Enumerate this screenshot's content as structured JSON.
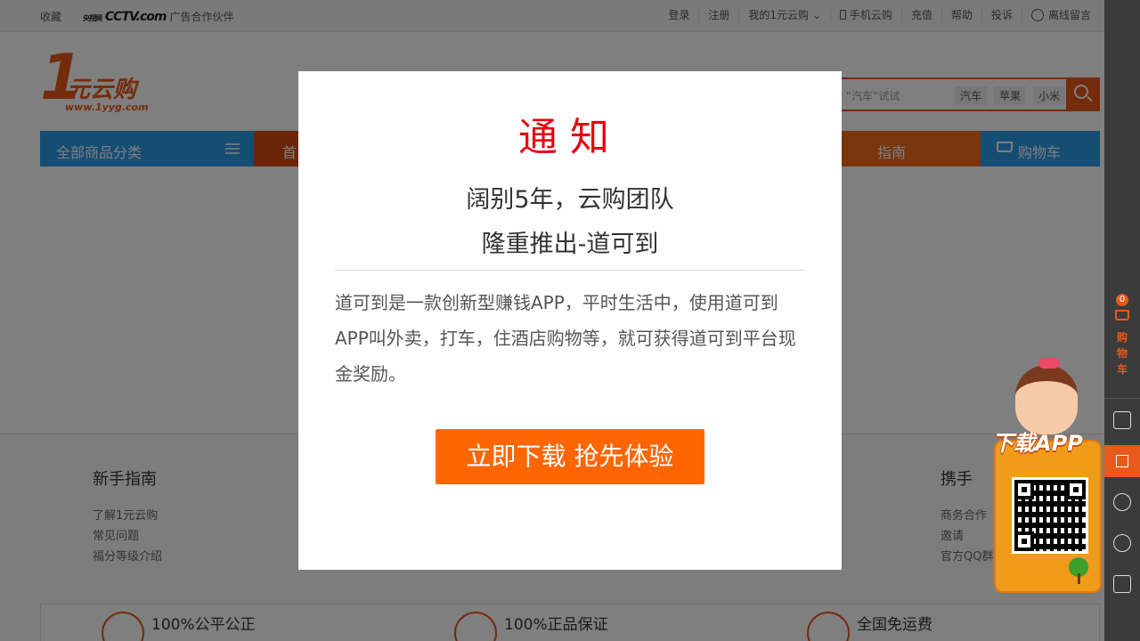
{
  "topbar": {
    "favorite": "收藏",
    "partner_logo": "CCTV.com",
    "partner_logo_cn": "央视网",
    "partner_text": "广告合作伙伴",
    "links": [
      "登录",
      "注册",
      "我的1元云购",
      "手机云购",
      "充值",
      "帮助",
      "投诉",
      "离线留言"
    ]
  },
  "header": {
    "logo_one": "1",
    "logo_name": "元云购",
    "logo_url": "www.1yyg.com",
    "search_placeholder": "“汽车”试试",
    "hot_tags": [
      "汽车",
      "苹果",
      "小米"
    ]
  },
  "nav": {
    "all_categories": "全部商品分类",
    "home": "首",
    "guide": "指南",
    "cart": "购物车"
  },
  "footer": {
    "col1_title": "新手指南",
    "col1_links": [
      "了解1元云购",
      "常见问题",
      "福分等级介绍"
    ],
    "col2_title": "携手",
    "col2_links": [
      "商务合作",
      "邀请",
      "官方QQ群"
    ],
    "guarantees": [
      "100%公平公正",
      "100%正品保证",
      "全国免运费"
    ]
  },
  "sidebar": {
    "cart_count": "0",
    "cart_label": "购物车",
    "app_label": "下载APP"
  },
  "modal": {
    "title": "通知",
    "subtitle_line1": "阔别5年，云购团队",
    "subtitle_line2": "隆重推出-道可到",
    "body": "道可到是一款创新型赚钱APP，平时生活中，使用道可到APP叫外卖，打车，住酒店购物等，就可获得道可到平台现金奖励。",
    "button": "立即下载 抢先体验"
  },
  "colors": {
    "brand_orange": "#e8591a",
    "nav_blue": "#2d9ae6",
    "title_red": "#e60012",
    "button_orange": "#ff6600"
  }
}
